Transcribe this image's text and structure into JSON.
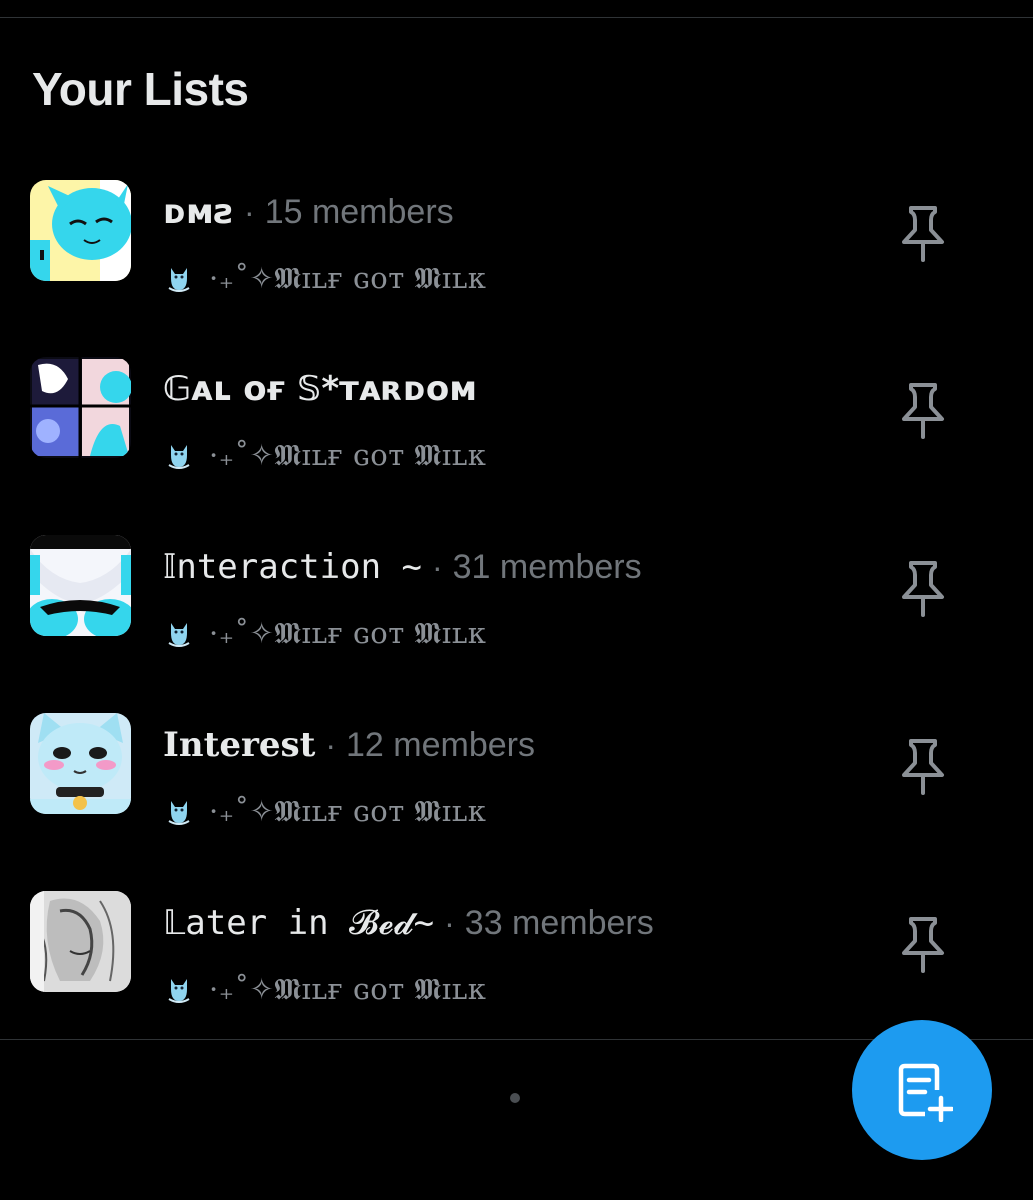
{
  "section": {
    "title": "Your Lists"
  },
  "lists": [
    {
      "name": "ᴅᴍꙅ",
      "separator": "·",
      "members": "15 members",
      "owner": "·₊˚✧𝕸ɪʟғ ɢᴏᴛ 𝕸ɪʟᴋ",
      "thumb_icon": "cartoon-cat-face-icon"
    },
    {
      "name": "𝔾ᴀʟ ᴏғ 𝕊*ᴛᴀʀᴅᴏᴍ",
      "separator": "",
      "members": "",
      "owner": "·₊˚✧𝕸ɪʟғ ɢᴏᴛ 𝕸ɪʟᴋ",
      "thumb_icon": "comic-panels-icon"
    },
    {
      "name": "𝕀nteraction ~",
      "separator": "·",
      "members": "31 members",
      "owner": "·₊˚✧𝕸ɪʟғ ɢᴏᴛ 𝕸ɪʟᴋ",
      "thumb_icon": "cartoon-blue-closeup-icon"
    },
    {
      "name": "Interest",
      "separator": "·",
      "members": "12 members",
      "owner": "·₊˚✧𝕸ɪʟғ ɢᴏᴛ 𝕸ɪʟᴋ",
      "thumb_icon": "cartoon-cat-collar-icon"
    },
    {
      "name": "𝕃ater in 𝓑𝓮𝓭~",
      "separator": "·",
      "members": "33 members",
      "owner": "·₊˚✧𝕸ɪʟғ ɢᴏᴛ 𝕸ɪʟᴋ",
      "thumb_icon": "sketch-grayscale-icon"
    }
  ],
  "fab": {
    "icon": "new-list-icon"
  },
  "colors": {
    "background": "#000000",
    "accent": "#1d9bf0",
    "text": "#e7e9ea",
    "secondary": "#71767b"
  }
}
